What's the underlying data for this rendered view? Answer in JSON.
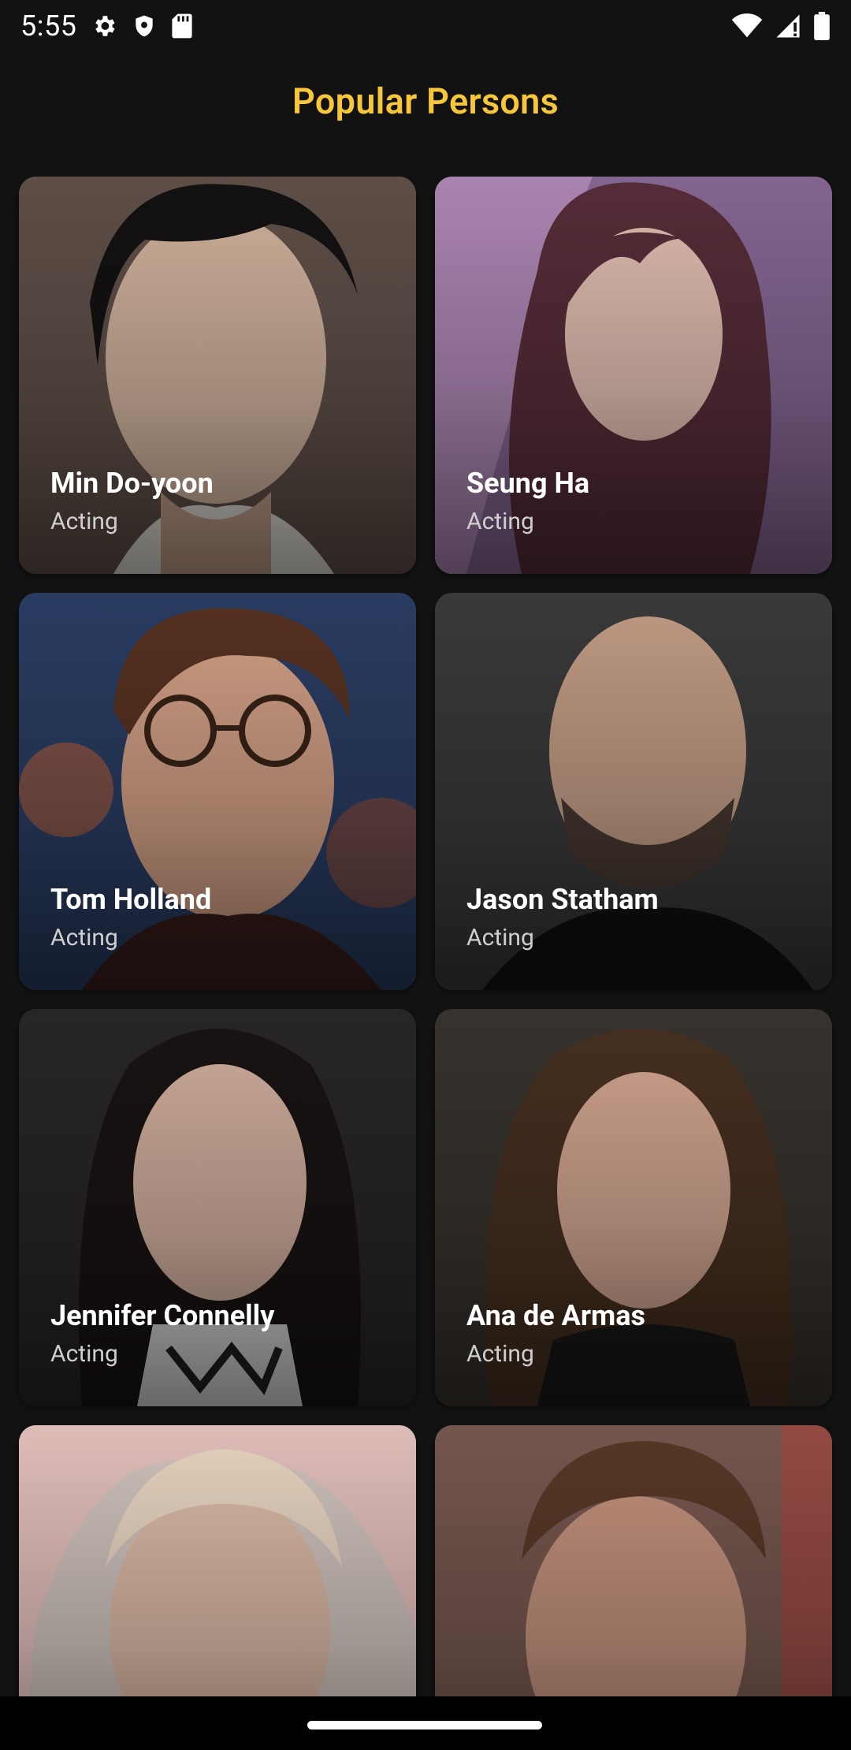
{
  "status_bar": {
    "time": "5:55",
    "left_icons": [
      "gear-icon",
      "shield-icon",
      "sd-card-icon"
    ],
    "right_icons": [
      "wifi-icon",
      "signal-icon",
      "battery-icon"
    ]
  },
  "header": {
    "title": "Popular Persons",
    "title_color": "#F7C63B"
  },
  "persons": [
    {
      "name": "Min Do-yoon",
      "department": "Acting"
    },
    {
      "name": "Seung Ha",
      "department": "Acting"
    },
    {
      "name": "Tom Holland",
      "department": "Acting"
    },
    {
      "name": "Jason Statham",
      "department": "Acting"
    },
    {
      "name": "Jennifer Connelly",
      "department": "Acting"
    },
    {
      "name": "Ana de Armas",
      "department": "Acting"
    },
    {
      "name": "",
      "department": ""
    },
    {
      "name": "",
      "department": ""
    }
  ],
  "colors": {
    "background": "#121212",
    "card_text": "#FFFFFF",
    "card_subtext": "#CFCFCF"
  }
}
